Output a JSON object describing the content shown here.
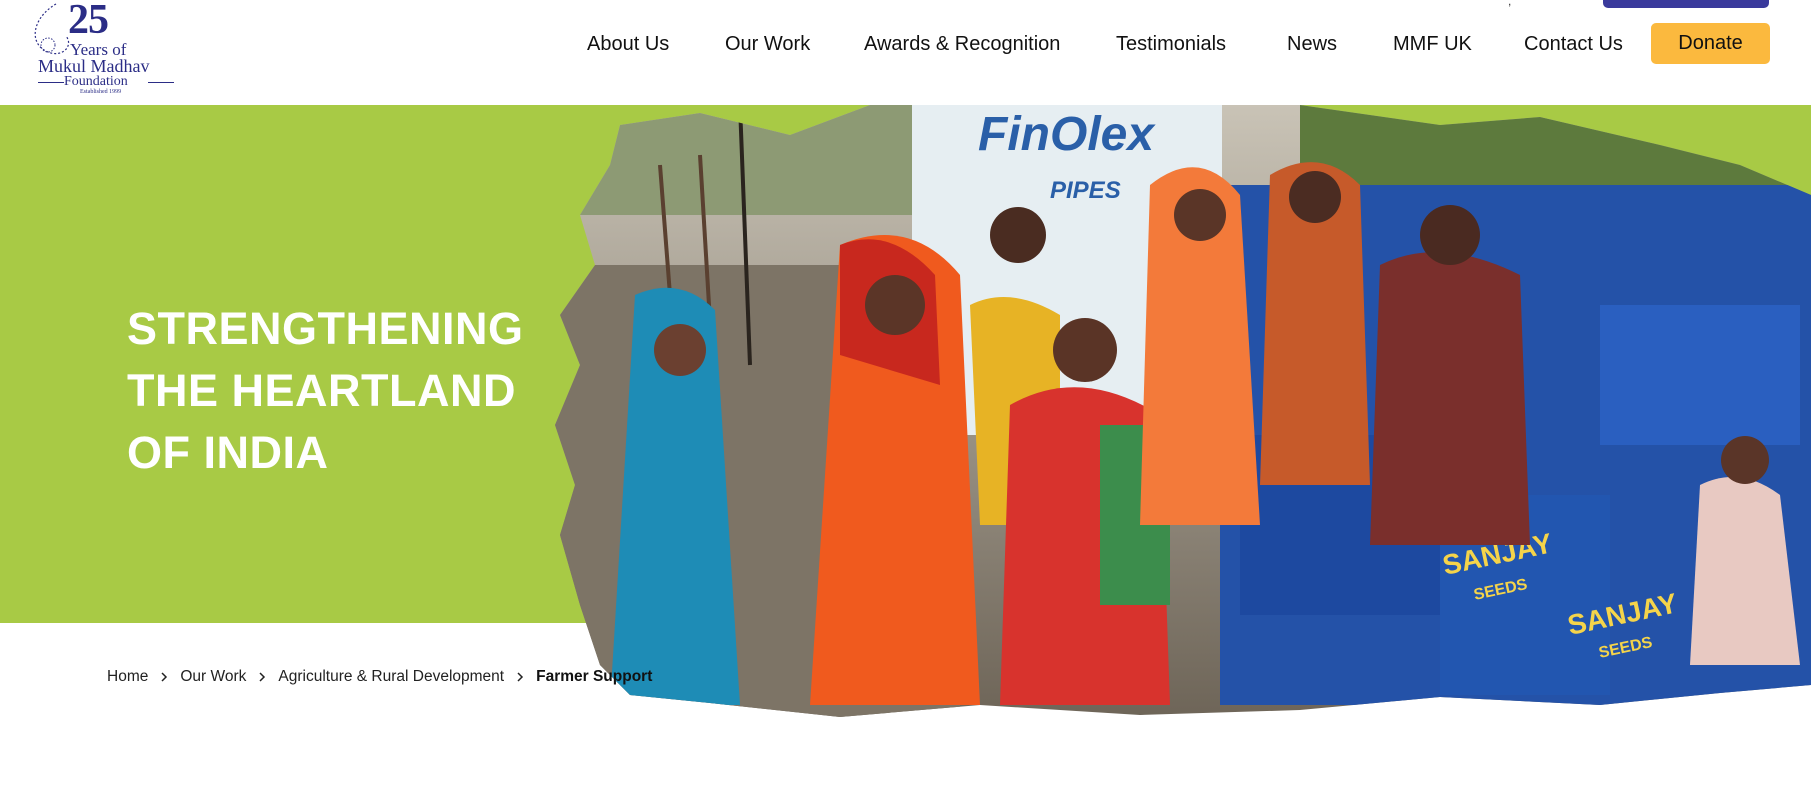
{
  "logo": {
    "number": "25",
    "line1": "Years of",
    "line2": "Mukul Madhav",
    "line3": "Foundation",
    "line4": "Established 1999"
  },
  "nav": {
    "items": [
      {
        "label": "About Us"
      },
      {
        "label": "Our Work"
      },
      {
        "label": "Awards & Recognition"
      },
      {
        "label": "Testimonials"
      },
      {
        "label": "News"
      },
      {
        "label": "MMF UK"
      },
      {
        "label": "Contact Us"
      }
    ],
    "donate_label": "Donate"
  },
  "hero": {
    "title_lines": [
      "STRENGTHENING",
      "THE HEARTLAND",
      "OF INDIA"
    ],
    "photo_signage": {
      "brand": "FinOlex",
      "sub": "PIPES",
      "bag_brand": "SANJAY",
      "bag_sub": "SEEDS"
    }
  },
  "breadcrumb": {
    "items": [
      "Home",
      "Our Work",
      "Agriculture & Rural Development",
      "Farmer Support"
    ]
  },
  "colors": {
    "hero_green": "#a8ca45",
    "donate_bg": "#fbb93e",
    "brand_navy": "#2b2d86"
  }
}
